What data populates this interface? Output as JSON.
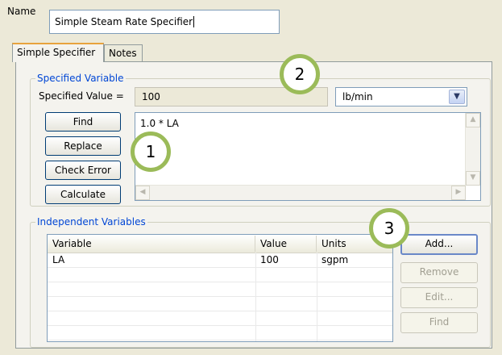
{
  "window": {
    "name_label": "Name",
    "name_value": "Simple Steam Rate Specifier"
  },
  "tabs": [
    {
      "label": "Simple Specifier",
      "active": true
    },
    {
      "label": "Notes",
      "active": false
    }
  ],
  "specified_variable": {
    "legend": "Specified Variable",
    "value_label": "Specified Value =",
    "value": "100",
    "unit": "lb/min",
    "formula": "1.0 * LA",
    "buttons": [
      "Find",
      "Replace",
      "Check Error",
      "Calculate"
    ]
  },
  "independent_variables": {
    "legend": "Independent Variables",
    "columns": [
      "Variable",
      "Value",
      "Units"
    ],
    "rows": [
      {
        "variable": "LA",
        "value": "100",
        "units": "sgpm"
      }
    ],
    "buttons": {
      "add": "Add...",
      "remove": "Remove",
      "edit": "Edit...",
      "find": "Find"
    }
  },
  "callouts": [
    "1",
    "2",
    "3"
  ],
  "colors": {
    "callout_ring": "#9bbb59",
    "legend_text": "#0046d5",
    "active_tab_accent": "#e8a33d"
  }
}
